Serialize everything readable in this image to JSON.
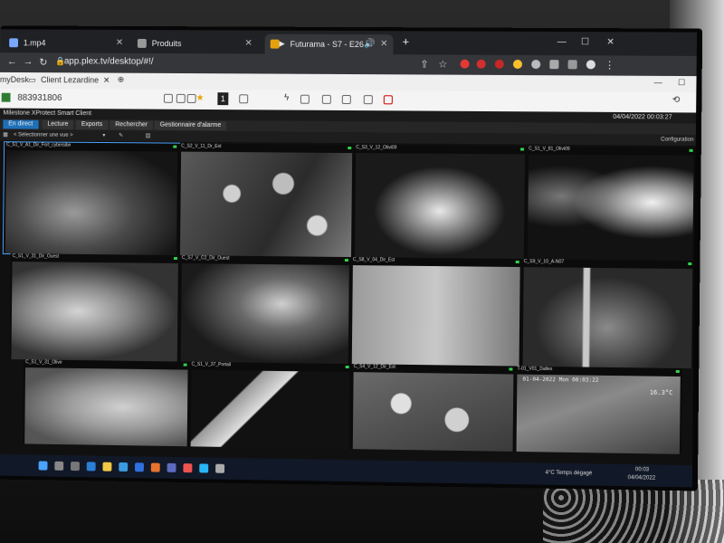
{
  "browser": {
    "tabs": [
      {
        "title": "1.mp4"
      },
      {
        "title": "Produits"
      },
      {
        "title": "Futurama - S7 - E26"
      }
    ],
    "url": "app.plex.tv/desktop/#!/"
  },
  "anydesk": {
    "app_name": "myDesk",
    "session_tab": "Client Lezardine",
    "remote_id": "883931806",
    "toolbar_number": "1"
  },
  "milestone": {
    "app_title": "Milestone XProtect Smart Client",
    "datetime": "04/04/2022 00:03:27",
    "tabs": [
      "En direct",
      "Lecture",
      "Exports",
      "Rechercher",
      "Gestionnaire d'alarme"
    ],
    "view_selector": "< Sélectionner une vue >",
    "configuration": "Configuration",
    "cameras": [
      {
        "label": "C_S1_V_A1_Dir_Fort_cybersibe"
      },
      {
        "label": "C_S2_V_11_Dr_Est"
      },
      {
        "label": "C_S3_V_12_Olivi09"
      },
      {
        "label": "C_S1_V_81_Olivi09"
      },
      {
        "label": "C_S1_V_31_Dir_Ouest"
      },
      {
        "label": "C_S7_V_C2_Dir_Ouest"
      },
      {
        "label": "C_S8_V_04_Dir_Est"
      },
      {
        "label": "C_S9_V_10_A-N07"
      },
      {
        "label": "C_S1_V_31_Olive"
      },
      {
        "label": "C_S1_V_37_Portail"
      },
      {
        "label": "C_S4_V_12_Dir_Est"
      },
      {
        "label": "T-01_V01_Dalles"
      }
    ],
    "overlay_timestamp": "01-04-2022 Mon 00:03:22",
    "overlay_temp": "16.3°C"
  },
  "taskbar": {
    "weather": "4°C Temps dégagé",
    "time": "00:03",
    "date": "04/04/2022"
  }
}
